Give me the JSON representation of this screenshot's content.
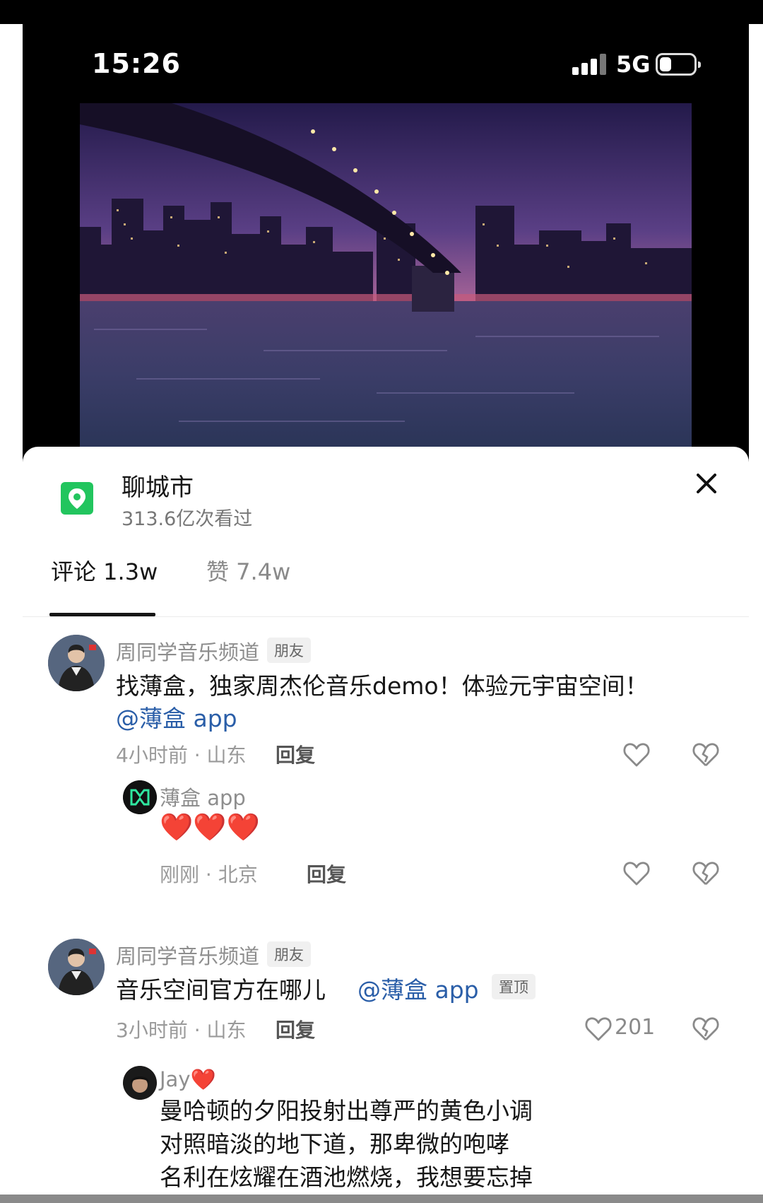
{
  "status_bar": {
    "time": "15:26",
    "network": "5G",
    "battery_level": 0.35
  },
  "location": {
    "title": "聊城市",
    "views": "313.6亿次看过"
  },
  "tabs": [
    {
      "label": "评论 1.3w",
      "active": true
    },
    {
      "label": "赞 7.4w",
      "active": false
    }
  ],
  "comments": [
    {
      "author": "周同学音乐频道",
      "badge": "朋友",
      "text": "找薄盒，独家周杰伦音乐demo！体验元宇宙空间！",
      "mention": "@薄盒 app",
      "meta": "4小时前 · 山东",
      "reply_label": "回复",
      "replies": [
        {
          "author": "薄盒 app",
          "text": "❤️❤️❤️",
          "meta": "刚刚 · 北京",
          "reply_label": "回复"
        }
      ]
    },
    {
      "author": "周同学音乐频道",
      "badge": "朋友",
      "text": "音乐空间官方在哪儿",
      "mention": "@薄盒 app",
      "pin_label": "置顶",
      "meta": "3小时前 · 山东",
      "reply_label": "回复",
      "like_count": "201",
      "replies": [
        {
          "author": "Jay❤️",
          "lines": [
            "曼哈顿的夕阳投射出尊严的黄色小调",
            "对照暗淡的地下道，那卑微的咆哮",
            "名利在炫耀在酒池燃烧，我想要忘掉"
          ]
        }
      ]
    }
  ],
  "colors": {
    "accent_mention": "#2a5ea8",
    "location_green": "#22c55e"
  }
}
